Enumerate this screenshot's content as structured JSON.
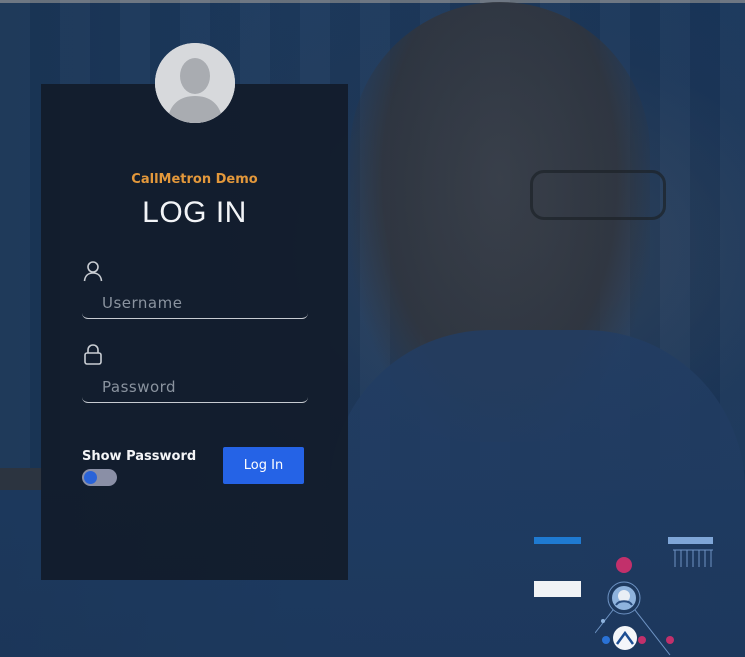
{
  "login": {
    "brand": "CallMetron Demo",
    "heading": "LOG IN",
    "username_placeholder": "Username",
    "password_placeholder": "Password",
    "show_password_label": "Show Password",
    "submit_label": "Log In",
    "show_password_on": false
  },
  "icons": {
    "avatar": "user-avatar-icon",
    "username": "user-icon",
    "password": "lock-icon"
  },
  "colors": {
    "brand": "#e3983b",
    "button": "#2563e6",
    "card": "#131d2c"
  }
}
